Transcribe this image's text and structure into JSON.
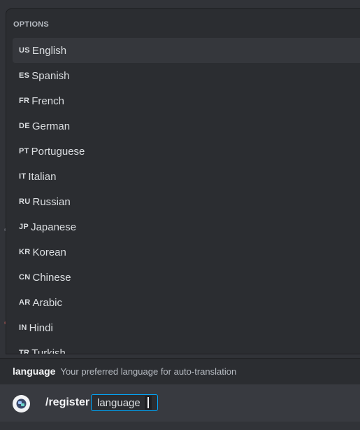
{
  "options_popout": {
    "header": "OPTIONS",
    "items": [
      {
        "flag": "US",
        "label": "English",
        "selected": true
      },
      {
        "flag": "ES",
        "label": "Spanish",
        "selected": false
      },
      {
        "flag": "FR",
        "label": "French",
        "selected": false
      },
      {
        "flag": "DE",
        "label": "German",
        "selected": false
      },
      {
        "flag": "PT",
        "label": "Portuguese",
        "selected": false
      },
      {
        "flag": "IT",
        "label": "Italian",
        "selected": false
      },
      {
        "flag": "RU",
        "label": "Russian",
        "selected": false
      },
      {
        "flag": "JP",
        "label": "Japanese",
        "selected": false
      },
      {
        "flag": "KR",
        "label": "Korean",
        "selected": false
      },
      {
        "flag": "CN",
        "label": "Chinese",
        "selected": false
      },
      {
        "flag": "AR",
        "label": "Arabic",
        "selected": false
      },
      {
        "flag": "IN",
        "label": "Hindi",
        "selected": false
      },
      {
        "flag": "TR",
        "label": "Turkish",
        "selected": false
      }
    ]
  },
  "hint": {
    "option_name": "language",
    "option_description": "Your preferred language for auto-translation"
  },
  "command_input": {
    "app_icon": "bot-app-icon",
    "command": "/register",
    "parameter": "language",
    "value": ""
  },
  "colors": {
    "background": "#313338",
    "popout": "#2b2d31",
    "selected_row": "#35373c",
    "chip_border": "#00a8fc",
    "text": "#dbdee1"
  }
}
